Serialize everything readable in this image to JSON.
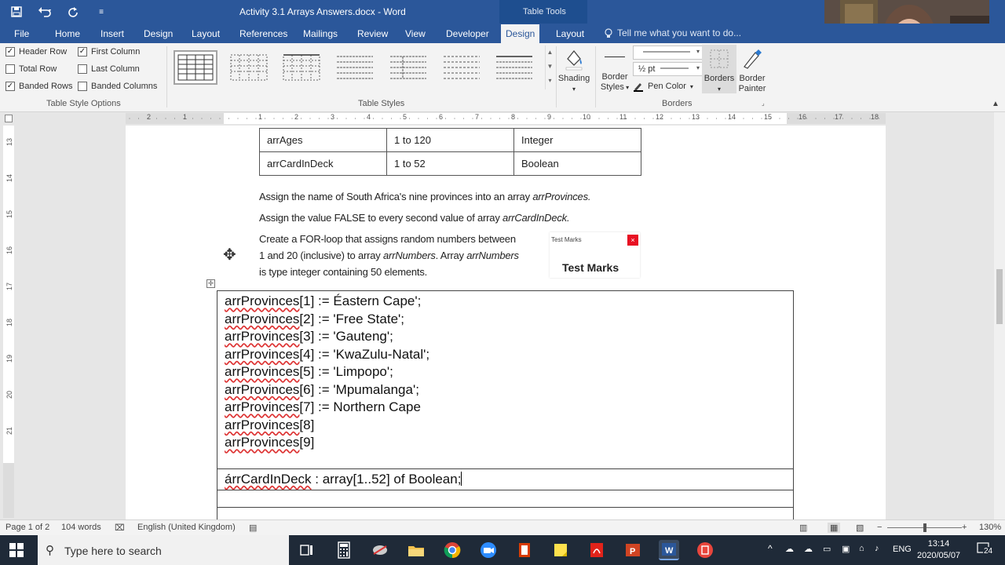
{
  "title_bar": {
    "document_title": "Activity 3.1 Arrays Answers.docx - Word",
    "context_label": "Table Tools",
    "quick_access": [
      "save-icon",
      "undo-icon",
      "redo-icon",
      "customize-icon"
    ]
  },
  "ribbon_tabs": [
    "File",
    "Home",
    "Insert",
    "Design",
    "Layout",
    "References",
    "Mailings",
    "Review",
    "View",
    "Developer",
    "Design",
    "Layout"
  ],
  "active_tab": "Design",
  "tell_me": "Tell me what you want to do...",
  "table_style_options": {
    "group_label": "Table Style Options",
    "options": [
      {
        "label": "Header Row",
        "checked": true
      },
      {
        "label": "First Column",
        "checked": true
      },
      {
        "label": "Total Row",
        "checked": false
      },
      {
        "label": "Last Column",
        "checked": false
      },
      {
        "label": "Banded Rows",
        "checked": true
      },
      {
        "label": "Banded Columns",
        "checked": false
      }
    ]
  },
  "table_styles": {
    "group_label": "Table Styles",
    "count": 7
  },
  "shading": {
    "label": "Shading"
  },
  "borders_group": {
    "group_label": "Borders",
    "border_styles_1": "Border",
    "border_styles_2": "Styles",
    "line_weight": "½ pt",
    "pen_color": "Pen Color",
    "borders_btn": "Borders",
    "border_painter_1": "Border",
    "border_painter_2": "Painter"
  },
  "ruler": {
    "h_numbers": [
      "2",
      "1",
      "1",
      "2",
      "3",
      "4",
      "5",
      "6",
      "7",
      "8",
      "9",
      "10",
      "11",
      "12",
      "13",
      "14",
      "15",
      "16",
      "17",
      "18"
    ],
    "v_numbers": [
      "13",
      "14",
      "15",
      "16",
      "17",
      "18",
      "19",
      "20",
      "21"
    ]
  },
  "doc": {
    "small_table": [
      [
        "arrAges",
        "1 to 120",
        "Integer"
      ],
      [
        "arrCardInDeck",
        "1 to 52",
        "Boolean"
      ]
    ],
    "para1_text": "Assign the name of South Africa's nine provinces into an array ",
    "para1_italic": "arrProvinces.",
    "para2_text": "Assign the value FALSE to every second value of array ",
    "para2_italic": "arrCardInDeck.",
    "para3_line1": "Create a FOR-loop that assigns random numbers between",
    "para3_line2_a": "1 and 20 (inclusive) to array ",
    "para3_line2_b": "arrNumbers",
    "para3_line2_c": ". Array ",
    "para3_line2_d": "arrNumbers",
    "para3_line3": "is type integer containing 50 elements.",
    "code_lines": [
      {
        "id": "arrProvinces",
        "rest": "[1] := Éastern Cape';"
      },
      {
        "id": "arrProvinces",
        "rest": "[2] := 'Free State';"
      },
      {
        "id": "arrProvinces",
        "rest": "[3] := 'Gauteng';"
      },
      {
        "id": "arrProvinces",
        "rest": "[4] := 'KwaZulu-Natal';"
      },
      {
        "id": "arrProvinces",
        "rest": "[5] := 'Limpopo';"
      },
      {
        "id": "arrProvinces",
        "rest": "[6] := 'Mpumalanga';"
      },
      {
        "id": "arrProvinces",
        "rest": "[7] := Northern Cape"
      },
      {
        "id": "arrProvinces",
        "rest": "[8]"
      },
      {
        "id": "arrProvinces",
        "rest": "[9]"
      }
    ],
    "code_line_2_id": "árrCardInDeck",
    "code_line_2_rest": " : array[1..52] of Boolean;"
  },
  "popup": {
    "title": "Test Marks",
    "body": "Test Marks",
    "close": "×"
  },
  "status_bar": {
    "page": "Page 1 of 2",
    "words": "104 words",
    "language": "English (United Kingdom)",
    "zoom": "130%"
  },
  "taskbar": {
    "search_placeholder": "Type here to search",
    "language": "ENG",
    "time": "13:14",
    "date": "2020/05/07",
    "notifications": "24"
  },
  "colors": {
    "word_blue": "#2b579a",
    "squiggle": "#d33333",
    "taskbar": "#1f2a38"
  }
}
